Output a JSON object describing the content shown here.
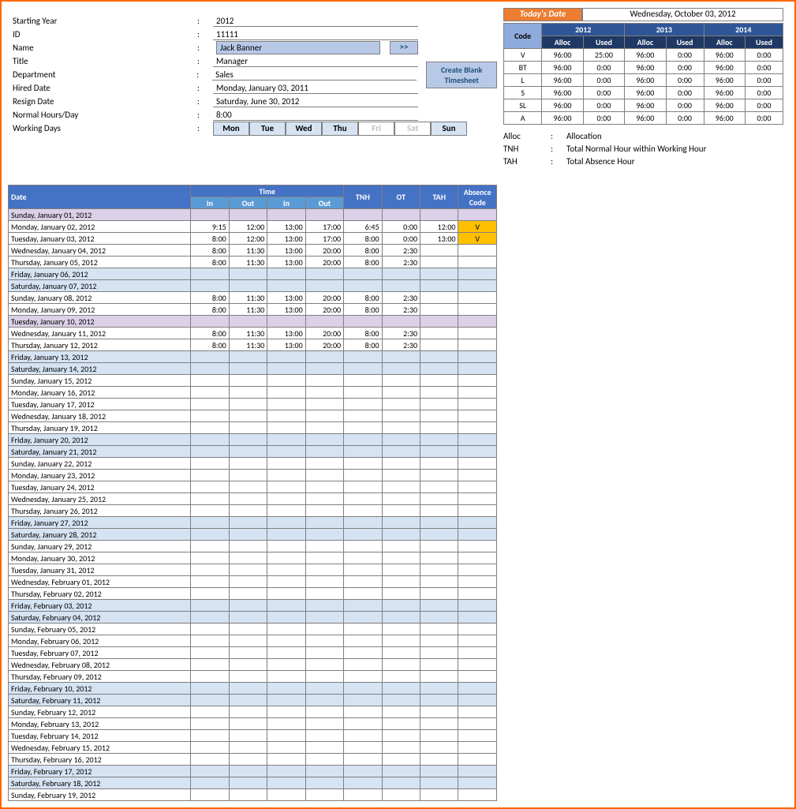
{
  "info": {
    "startingYear": {
      "label": "Starting Year",
      "value": "2012"
    },
    "id": {
      "label": "ID",
      "value": "11111"
    },
    "name": {
      "label": "Name",
      "value": "Jack Banner"
    },
    "title": {
      "label": "Title",
      "value": "Manager"
    },
    "department": {
      "label": "Department",
      "value": "Sales"
    },
    "hiredDate": {
      "label": "Hired Date",
      "value": "Monday, January 03, 2011"
    },
    "resignDate": {
      "label": "Resign Date",
      "value": "Saturday, June 30, 2012"
    },
    "normalHours": {
      "label": "Normal Hours/Day",
      "value": "8:00"
    },
    "workingDays": {
      "label": "Working Days"
    }
  },
  "navBtn": ">>",
  "createBlank": {
    "l1": "Create Blank",
    "l2": "Timesheet"
  },
  "days": [
    {
      "t": "Mon",
      "on": true
    },
    {
      "t": "Tue",
      "on": true
    },
    {
      "t": "Wed",
      "on": true
    },
    {
      "t": "Thu",
      "on": true
    },
    {
      "t": "Fri",
      "on": false
    },
    {
      "t": "Sat",
      "on": false
    },
    {
      "t": "Sun",
      "on": true
    }
  ],
  "today": {
    "label": "Today's Date",
    "value": "Wednesday, October 03, 2012"
  },
  "alloc": {
    "codeHd": "Code",
    "years": [
      "2012",
      "2013",
      "2014"
    ],
    "sub": [
      "Alloc",
      "Used"
    ],
    "rows": [
      {
        "c": "V",
        "v": [
          "96:00",
          "25:00",
          "96:00",
          "0:00",
          "96:00",
          "0:00"
        ]
      },
      {
        "c": "BT",
        "v": [
          "96:00",
          "0:00",
          "96:00",
          "0:00",
          "96:00",
          "0:00"
        ]
      },
      {
        "c": "L",
        "v": [
          "96:00",
          "0:00",
          "96:00",
          "0:00",
          "96:00",
          "0:00"
        ]
      },
      {
        "c": "S",
        "v": [
          "96:00",
          "0:00",
          "96:00",
          "0:00",
          "96:00",
          "0:00"
        ]
      },
      {
        "c": "SL",
        "v": [
          "96:00",
          "0:00",
          "96:00",
          "0:00",
          "96:00",
          "0:00"
        ]
      },
      {
        "c": "A",
        "v": [
          "96:00",
          "0:00",
          "96:00",
          "0:00",
          "96:00",
          "0:00"
        ]
      }
    ]
  },
  "legend": [
    {
      "k": "Alloc",
      "v": "Allocation"
    },
    {
      "k": "TNH",
      "v": "Total Normal Hour within Working Hour"
    },
    {
      "k": "TAH",
      "v": "Total Absence Hour"
    }
  ],
  "ts": {
    "hd": {
      "date": "Date",
      "time": "Time",
      "in": "In",
      "out": "Out",
      "tnh": "TNH",
      "ot": "OT",
      "tah": "TAH",
      "abs": "Absence Code"
    },
    "rows": [
      {
        "d": "Sunday, January 01, 2012",
        "cls": "holiday"
      },
      {
        "d": "Monday, January 02, 2012",
        "t": [
          "9:15",
          "12:00",
          "13:00",
          "17:00"
        ],
        "tnh": "6:45",
        "ot": "0:00",
        "tah": "12:00",
        "abs": "V"
      },
      {
        "d": "Tuesday, January 03, 2012",
        "t": [
          "8:00",
          "12:00",
          "13:00",
          "17:00"
        ],
        "tnh": "8:00",
        "ot": "0:00",
        "tah": "13:00",
        "abs": "V"
      },
      {
        "d": "Wednesday, January 04, 2012",
        "t": [
          "8:00",
          "11:30",
          "13:00",
          "20:00"
        ],
        "tnh": "8:00",
        "ot": "2:30"
      },
      {
        "d": "Thursday, January 05, 2012",
        "t": [
          "8:00",
          "11:30",
          "13:00",
          "20:00"
        ],
        "tnh": "8:00",
        "ot": "2:30"
      },
      {
        "d": "Friday, January 06, 2012",
        "cls": "weekend"
      },
      {
        "d": "Saturday, January 07, 2012",
        "cls": "weekend"
      },
      {
        "d": "Sunday, January 08, 2012",
        "t": [
          "8:00",
          "11:30",
          "13:00",
          "20:00"
        ],
        "tnh": "8:00",
        "ot": "2:30"
      },
      {
        "d": "Monday, January 09, 2012",
        "t": [
          "8:00",
          "11:30",
          "13:00",
          "20:00"
        ],
        "tnh": "8:00",
        "ot": "2:30"
      },
      {
        "d": "Tuesday, January 10, 2012",
        "cls": "holiday"
      },
      {
        "d": "Wednesday, January 11, 2012",
        "t": [
          "8:00",
          "11:30",
          "13:00",
          "20:00"
        ],
        "tnh": "8:00",
        "ot": "2:30"
      },
      {
        "d": "Thursday, January 12, 2012",
        "t": [
          "8:00",
          "11:30",
          "13:00",
          "20:00"
        ],
        "tnh": "8:00",
        "ot": "2:30"
      },
      {
        "d": "Friday, January 13, 2012",
        "cls": "weekend"
      },
      {
        "d": "Saturday, January 14, 2012",
        "cls": "weekend"
      },
      {
        "d": "Sunday, January 15, 2012"
      },
      {
        "d": "Monday, January 16, 2012"
      },
      {
        "d": "Tuesday, January 17, 2012"
      },
      {
        "d": "Wednesday, January 18, 2012"
      },
      {
        "d": "Thursday, January 19, 2012"
      },
      {
        "d": "Friday, January 20, 2012",
        "cls": "weekend"
      },
      {
        "d": "Saturday, January 21, 2012",
        "cls": "weekend"
      },
      {
        "d": "Sunday, January 22, 2012"
      },
      {
        "d": "Monday, January 23, 2012"
      },
      {
        "d": "Tuesday, January 24, 2012"
      },
      {
        "d": "Wednesday, January 25, 2012"
      },
      {
        "d": "Thursday, January 26, 2012"
      },
      {
        "d": "Friday, January 27, 2012",
        "cls": "weekend"
      },
      {
        "d": "Saturday, January 28, 2012",
        "cls": "weekend"
      },
      {
        "d": "Sunday, January 29, 2012"
      },
      {
        "d": "Monday, January 30, 2012"
      },
      {
        "d": "Tuesday, January 31, 2012"
      },
      {
        "d": "Wednesday, February 01, 2012"
      },
      {
        "d": "Thursday, February 02, 2012"
      },
      {
        "d": "Friday, February 03, 2012",
        "cls": "weekend"
      },
      {
        "d": "Saturday, February 04, 2012",
        "cls": "weekend"
      },
      {
        "d": "Sunday, February 05, 2012"
      },
      {
        "d": "Monday, February 06, 2012"
      },
      {
        "d": "Tuesday, February 07, 2012"
      },
      {
        "d": "Wednesday, February 08, 2012"
      },
      {
        "d": "Thursday, February 09, 2012"
      },
      {
        "d": "Friday, February 10, 2012",
        "cls": "weekend"
      },
      {
        "d": "Saturday, February 11, 2012",
        "cls": "weekend"
      },
      {
        "d": "Sunday, February 12, 2012"
      },
      {
        "d": "Monday, February 13, 2012"
      },
      {
        "d": "Tuesday, February 14, 2012"
      },
      {
        "d": "Wednesday, February 15, 2012"
      },
      {
        "d": "Thursday, February 16, 2012"
      },
      {
        "d": "Friday, February 17, 2012",
        "cls": "weekend"
      },
      {
        "d": "Saturday, February 18, 2012",
        "cls": "weekend"
      },
      {
        "d": "Sunday, February 19, 2012"
      }
    ]
  }
}
